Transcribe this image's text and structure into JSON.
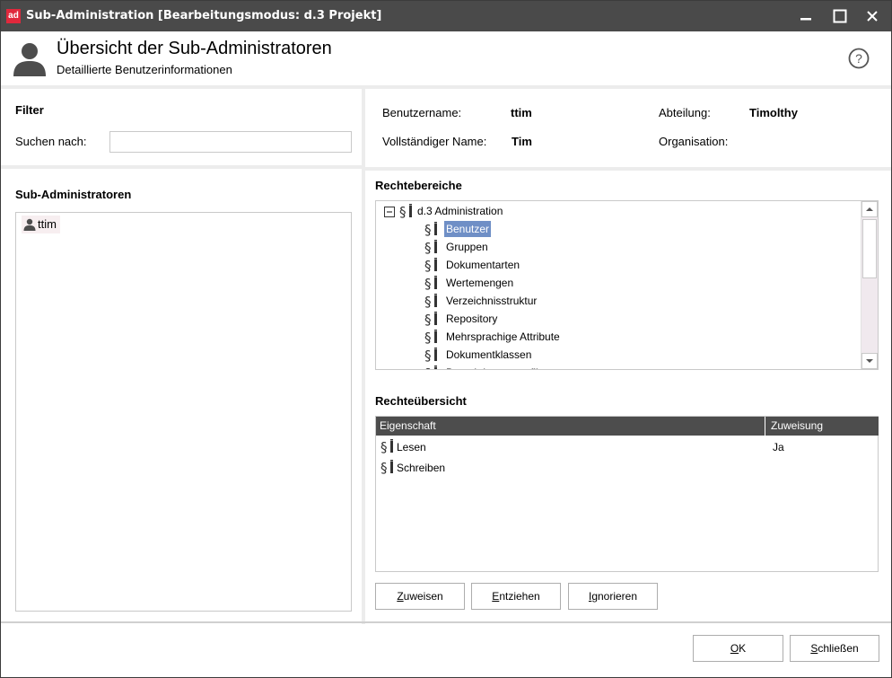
{
  "window": {
    "logo": "ad",
    "title": "Sub-Administration [Bearbeitungsmodus: d.3 Projekt]",
    "minimize": "–",
    "maximize": "☐",
    "close": "✕"
  },
  "header": {
    "title": "Übersicht der Sub-Administratoren",
    "subtitle": "Detaillierte Benutzerinformationen",
    "help": "?"
  },
  "filter": {
    "heading": "Filter",
    "search_label": "Suchen nach:",
    "search_value": ""
  },
  "user_info": {
    "username_label": "Benutzername:",
    "username_value": "ttim",
    "fullname_label": "Vollständiger Name:",
    "fullname_value": "Tim",
    "department_label": "Abteilung:",
    "department_value": "Timolthy",
    "organization_label": "Organisation:",
    "organization_value": ""
  },
  "subadmins": {
    "heading": "Sub-Administratoren",
    "items": [
      {
        "name": "ttim"
      }
    ]
  },
  "rights_areas": {
    "heading": "Rechtebereiche",
    "root": {
      "expander": "⊟",
      "label": "d.3 Administration"
    },
    "items": [
      {
        "label": "Benutzer",
        "selected": true
      },
      {
        "label": "Gruppen"
      },
      {
        "label": "Dokumentarten"
      },
      {
        "label": "Wertemengen"
      },
      {
        "label": "Verzeichnisstruktur"
      },
      {
        "label": "Repository"
      },
      {
        "label": "Mehrsprachige Attribute"
      },
      {
        "label": "Dokumentklassen"
      },
      {
        "label": "Berechtigungsprofile"
      }
    ]
  },
  "rights_overview": {
    "heading": "Rechteübersicht",
    "columns": [
      "Eigenschaft",
      "Zuweisung"
    ],
    "rows": [
      {
        "property": "Lesen",
        "assignment": "Ja"
      },
      {
        "property": "Schreiben",
        "assignment": ""
      }
    ]
  },
  "actions": {
    "assign": {
      "mnemonic": "Z",
      "rest": "uweisen"
    },
    "revoke": {
      "mnemonic": "E",
      "rest": "ntziehen"
    },
    "ignore": {
      "mnemonic": "I",
      "rest": "gnorieren"
    }
  },
  "footer": {
    "ok": {
      "mnemonic": "O",
      "rest": "K"
    },
    "close": {
      "mnemonic": "S",
      "rest": "chließen"
    }
  },
  "colors": {
    "titlebar": "#4a4a4a",
    "logo": "#e0283c",
    "selection": "#6f8fc6",
    "table_header": "#4d4d4d"
  }
}
